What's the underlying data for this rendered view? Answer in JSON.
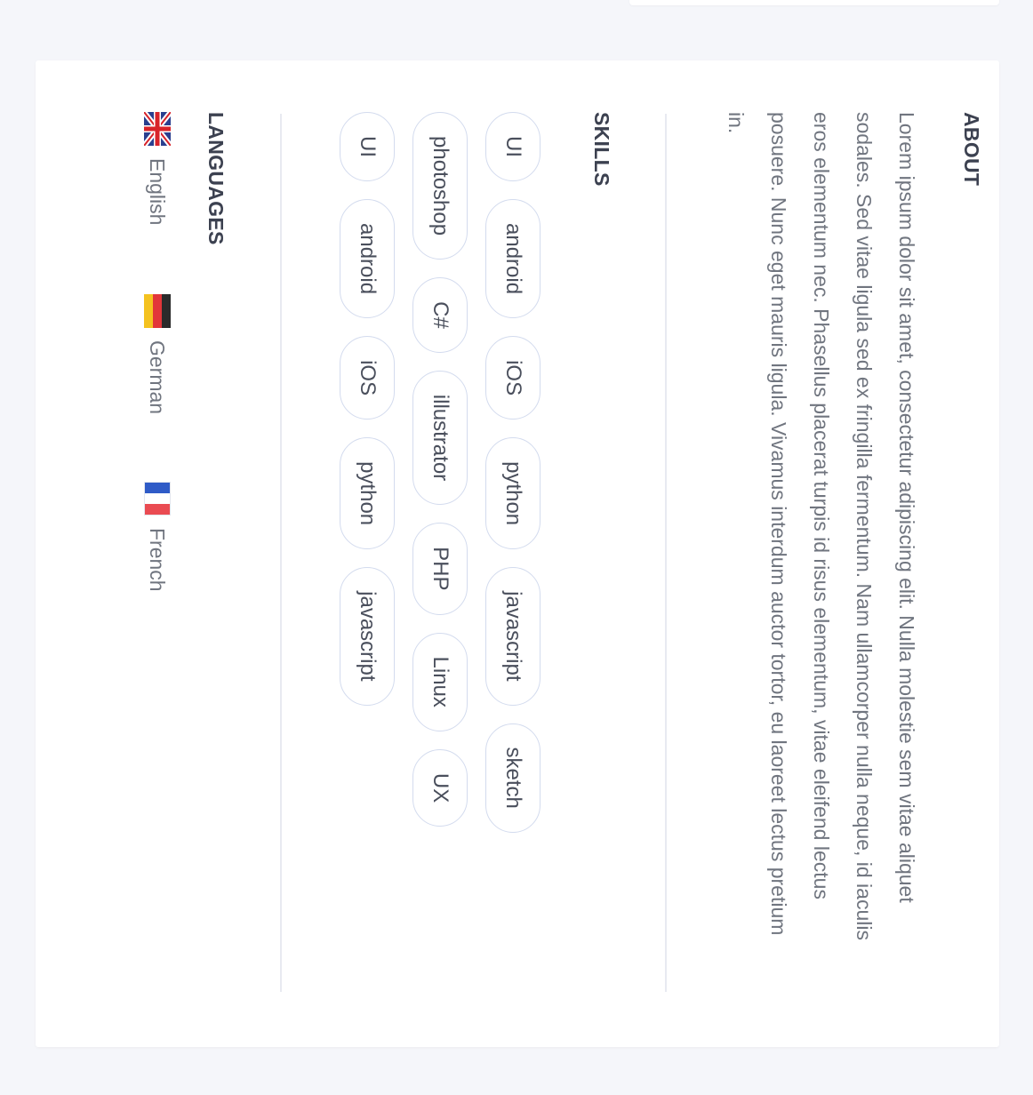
{
  "about": {
    "heading": "ABOUT",
    "text": "Lorem ipsum dolor sit amet, consectetur adipiscing elit. Nulla molestie sem vitae aliquet sodales. Sed vitae ligula sed ex fringilla fermentum. Nam ullamcorper nulla neque, id iaculis eros elementum nec. Phasellus placerat turpis id risus elementum, vitae eleifend lectus posuere. Nunc eget mauris ligula. Vivamus interdum auctor tortor, eu laoreet lectus pretium in."
  },
  "skills": {
    "heading": "SKILLS",
    "rows": [
      [
        "UI",
        "android",
        "iOS",
        "python",
        "javascript",
        "sketch"
      ],
      [
        "photoshop",
        "C#",
        "illustrator",
        "PHP",
        "Linux",
        "UX"
      ],
      [
        "UI",
        "android",
        "iOS",
        "python",
        "javascript"
      ]
    ]
  },
  "languages": {
    "heading": "LANGUAGES",
    "items": [
      {
        "label": "English",
        "flag": "uk-flag-icon"
      },
      {
        "label": "German",
        "flag": "germany-flag-icon"
      },
      {
        "label": "French",
        "flag": "france-flag-icon"
      }
    ]
  },
  "colors": {
    "background": "#f5f6fa",
    "card": "#ffffff",
    "heading": "#3c4150",
    "body_text": "#70757f",
    "chip_border": "#d3dbee",
    "divider": "#e8eaf1"
  }
}
